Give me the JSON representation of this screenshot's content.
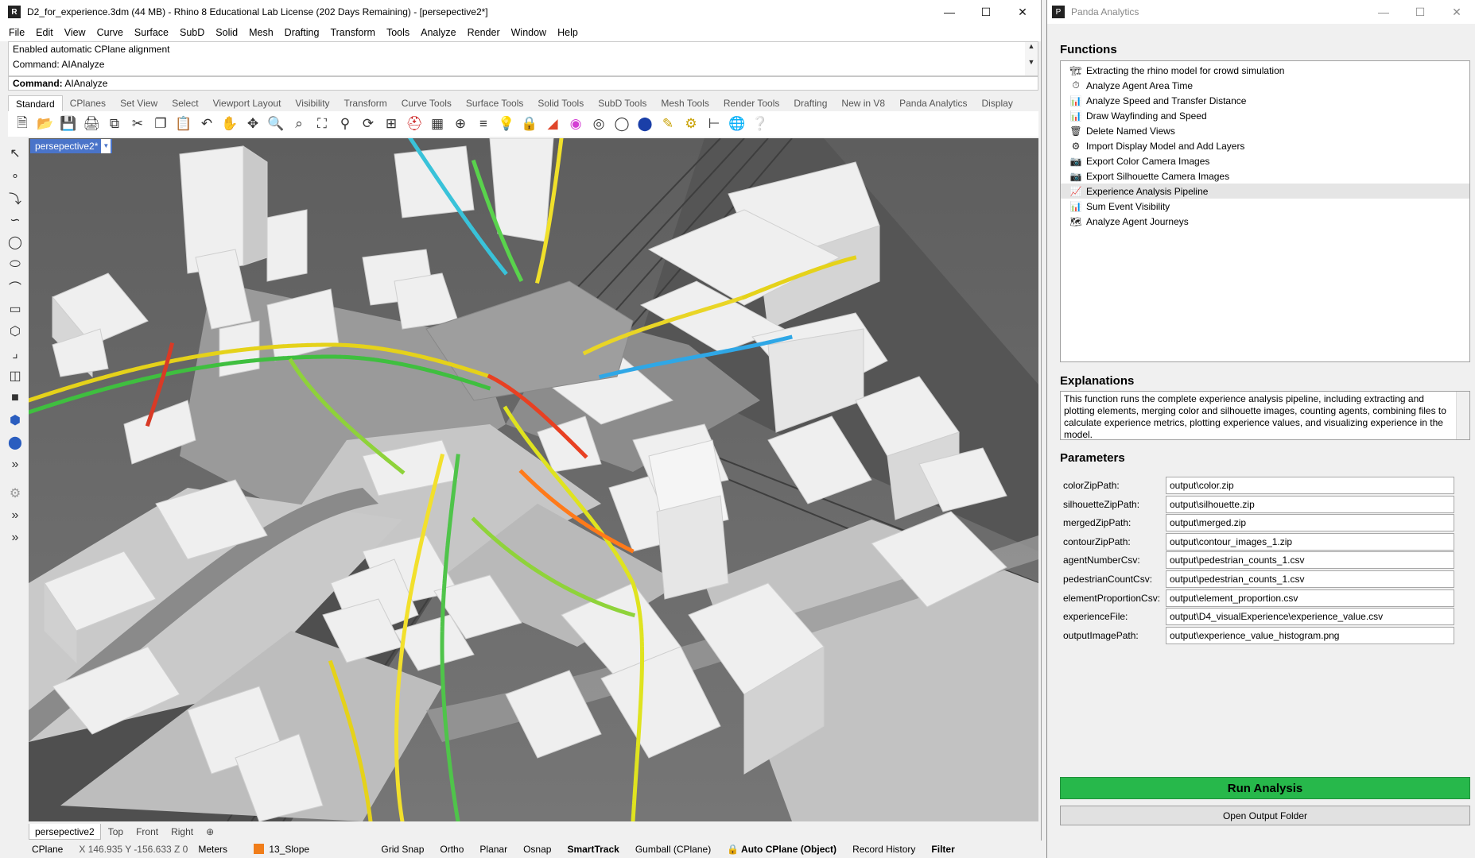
{
  "rhino": {
    "title": "D2_for_experience.3dm (44 MB) - Rhino 8 Educational Lab License (202 Days Remaining) - [persepective2*]",
    "menu": [
      "File",
      "Edit",
      "View",
      "Curve",
      "Surface",
      "SubD",
      "Solid",
      "Mesh",
      "Drafting",
      "Transform",
      "Tools",
      "Analyze",
      "Render",
      "Window",
      "Help"
    ],
    "history": [
      "Enabled automatic CPlane alignment",
      "Command: AIAnalyze"
    ],
    "command_label": "Command:",
    "command_value": "AIAnalyze",
    "toolbar_tabs": [
      "Standard",
      "CPlanes",
      "Set View",
      "Select",
      "Viewport Layout",
      "Visibility",
      "Transform",
      "Curve Tools",
      "Surface Tools",
      "Solid Tools",
      "SubD Tools",
      "Mesh Tools",
      "Render Tools",
      "Drafting",
      "New in V8",
      "Panda Analytics",
      "Display"
    ],
    "viewport_title": "persepective2*",
    "viewport_tabs": [
      "persepective2",
      "Top",
      "Front",
      "Right"
    ],
    "status": {
      "cplane": "CPlane",
      "coords": "X 146.935 Y -156.633 Z 0",
      "units": "Meters",
      "layer": "13_Slope",
      "layer_color": "#f07d1a",
      "grid_snap": "Grid Snap",
      "ortho": "Ortho",
      "planar": "Planar",
      "osnap": "Osnap",
      "smarttrack": "SmartTrack",
      "gumball": "Gumball (CPlane)",
      "auto_cplane": "Auto CPlane (Object)",
      "record_history": "Record History",
      "filter": "Filter"
    }
  },
  "panda": {
    "title": "Panda Analytics",
    "functions_heading": "Functions",
    "functions": [
      {
        "label": "Extracting the rhino model for crowd simulation",
        "icon": "model-extract-icon"
      },
      {
        "label": "Analyze Agent Area Time",
        "icon": "clock-icon"
      },
      {
        "label": "Analyze Speed and Transfer Distance",
        "icon": "bar-chart-icon"
      },
      {
        "label": "Draw Wayfinding and Speed",
        "icon": "bar-chart-icon"
      },
      {
        "label": "Delete Named Views",
        "icon": "trash-icon"
      },
      {
        "label": "Import Display Model and Add Layers",
        "icon": "import-icon"
      },
      {
        "label": "Export Color Camera Images",
        "icon": "camera-icon"
      },
      {
        "label": "Export Silhouette Camera Images",
        "icon": "camera-icon"
      },
      {
        "label": "Experience Analysis Pipeline",
        "icon": "pipeline-icon"
      },
      {
        "label": "Sum Event Visibility",
        "icon": "bar-chart-icon"
      },
      {
        "label": "Analyze Agent Journeys",
        "icon": "journey-icon"
      }
    ],
    "selected_index": 8,
    "explanations_heading": "Explanations",
    "explanation": "This function runs the complete experience analysis pipeline, including extracting and plotting elements, merging color and silhouette images, counting agents, combining files to calculate experience metrics, plotting experience values, and visualizing experience in the model.",
    "parameters_heading": "Parameters",
    "parameters": [
      {
        "label": "colorZipPath:",
        "value": "output\\color.zip"
      },
      {
        "label": "silhouetteZipPath:",
        "value": "output\\silhouette.zip"
      },
      {
        "label": "mergedZipPath:",
        "value": "output\\merged.zip"
      },
      {
        "label": "contourZipPath:",
        "value": "output\\contour_images_1.zip"
      },
      {
        "label": "agentNumberCsv:",
        "value": "output\\pedestrian_counts_1.csv"
      },
      {
        "label": "pedestrianCountCsv:",
        "value": "output\\pedestrian_counts_1.csv"
      },
      {
        "label": "elementProportionCsv:",
        "value": "output\\element_proportion.csv"
      },
      {
        "label": "experienceFile:",
        "value": "output\\D4_visualExperience\\experience_value.csv"
      },
      {
        "label": "outputImagePath:",
        "value": "output\\experience_value_histogram.png"
      }
    ],
    "run_label": "Run Analysis",
    "open_label": "Open Output Folder",
    "run_color": "#27b84b"
  }
}
